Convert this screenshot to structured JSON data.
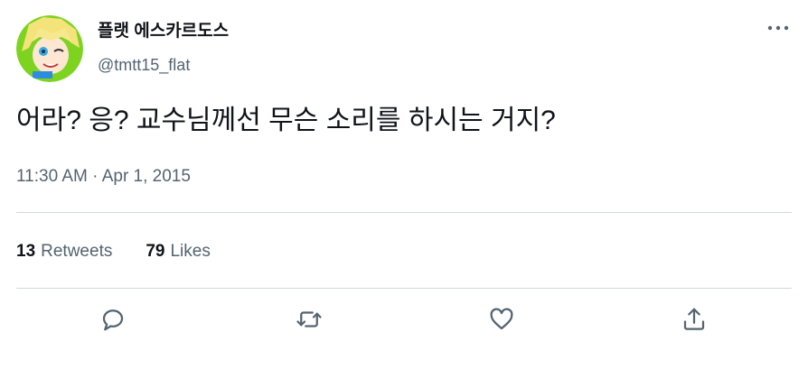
{
  "author": {
    "display_name": "플랫 에스카르도스",
    "handle": "@tmtt15_flat",
    "avatar_icon": "anime-character-avatar"
  },
  "tweet": {
    "text": "어라? 응? 교수님께선 무슨 소리를 하시는 거지?",
    "timestamp": "11:30 AM · Apr 1, 2015"
  },
  "stats": {
    "retweets_count": "13",
    "retweets_label": "Retweets",
    "likes_count": "79",
    "likes_label": "Likes"
  },
  "actions": [
    "reply-icon",
    "retweet-icon",
    "like-icon",
    "share-icon"
  ],
  "colors": {
    "text_primary": "#0f1419",
    "text_secondary": "#536471",
    "divider": "#cfd9de",
    "icon": "#536471"
  }
}
